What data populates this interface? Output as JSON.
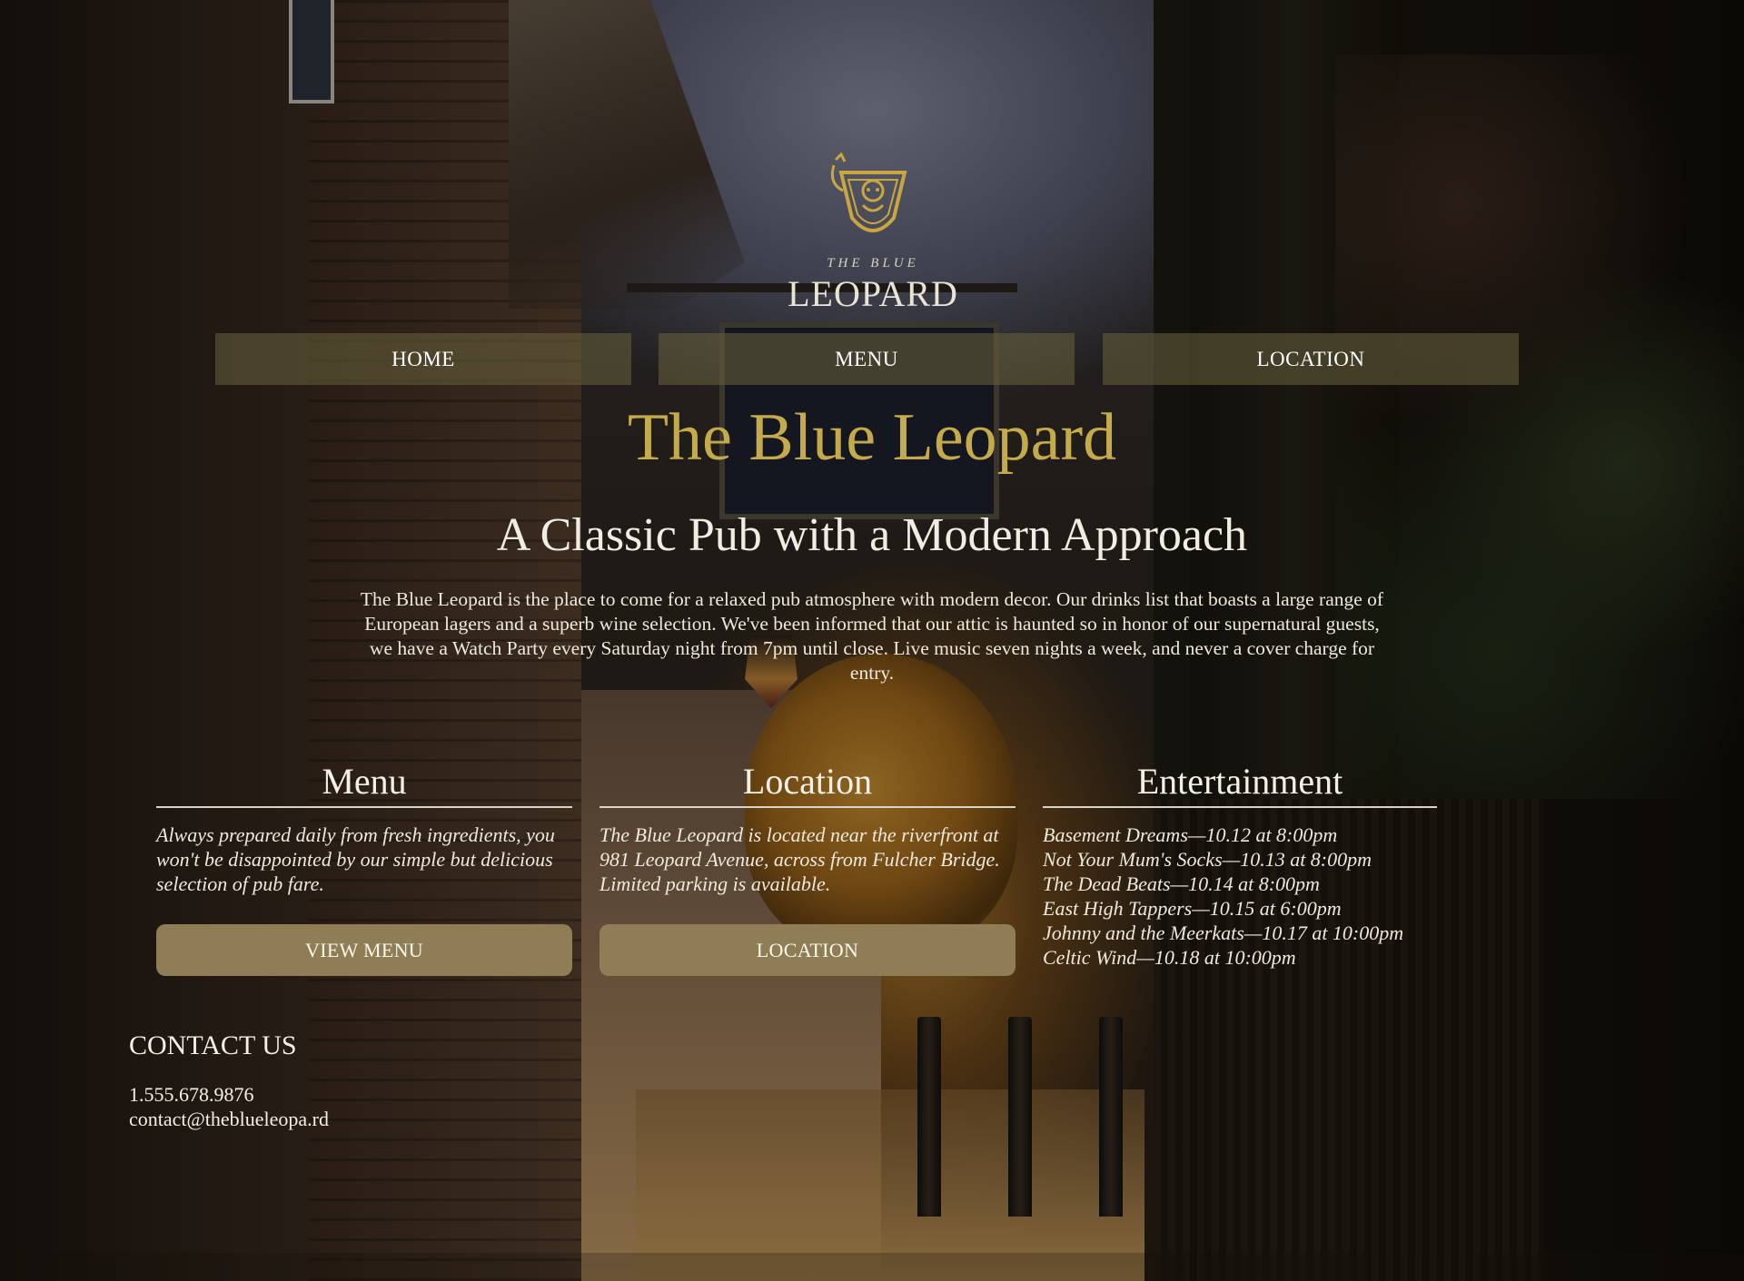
{
  "logo": {
    "small_text": "THE BLUE",
    "big_text": "LEOPARD",
    "crest_icon": "leopard-crest-icon",
    "accent": "#c4aa4b"
  },
  "nav": {
    "items": [
      {
        "label": "HOME"
      },
      {
        "label": "MENU"
      },
      {
        "label": "LOCATION"
      }
    ]
  },
  "hero": {
    "title": "The Blue Leopard",
    "subtitle": "A Classic Pub with a Modern Approach",
    "intro": "The Blue Leopard is the place to come for a relaxed pub atmosphere with modern decor. Our drinks list that boasts a large range of European lagers and a superb wine selection. We've been informed that our attic is haunted so in honor of our supernatural guests, we have a Watch Party every Saturday night from 7pm until close. Live music seven nights a week, and never a cover charge for entry."
  },
  "sections": {
    "menu": {
      "heading": "Menu",
      "description": "Always prepared daily from fresh ingredients, you won't be disappointed by our simple but delicious selection of pub fare.",
      "button_label": "VIEW MENU"
    },
    "location": {
      "heading": "Location",
      "description": "The Blue Leopard is located near the riverfront at 981 Leopard Avenue, across from Fulcher Bridge. Limited parking is available.",
      "button_label": "LOCATION"
    },
    "entertainment": {
      "heading": "Entertainment",
      "events": [
        "Basement Dreams—10.12 at 8:00pm",
        "Not Your Mum's Socks—10.13 at 8:00pm",
        "The Dead Beats—10.14 at 8:00pm",
        "East High Tappers—10.15 at 6:00pm",
        "Johnny and the Meerkats—10.17 at 10:00pm",
        "Celtic Wind—10.18 at 10:00pm"
      ]
    }
  },
  "contact": {
    "heading": "CONTACT US",
    "phone": "1.555.678.9876",
    "email": "contact@theblueleopa.rd"
  },
  "colors": {
    "nav_bg": "#6a623e",
    "button_bg": "#8e7d55",
    "title_gold": "#c4aa4b"
  }
}
